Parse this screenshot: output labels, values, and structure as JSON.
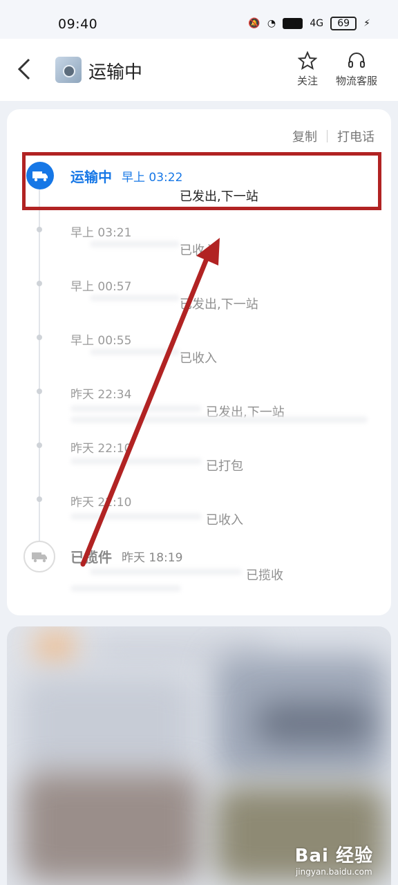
{
  "status_bar": {
    "time": "09:40",
    "network": "4G",
    "hd": "HD",
    "battery": "69"
  },
  "header": {
    "title": "运输中",
    "follow_label": "关注",
    "service_label": "物流客服"
  },
  "card": {
    "copy_label": "复制",
    "call_label": "打电话"
  },
  "timeline": {
    "current": {
      "status": "运输中",
      "time": "早上 03:22",
      "desc": "已发出,下一站"
    },
    "events": [
      {
        "time": "早上 03:21",
        "desc": "已收入"
      },
      {
        "time": "早上 00:57",
        "desc": "已发出,下一站"
      },
      {
        "time": "早上 00:55",
        "desc": "已收入"
      },
      {
        "time": "昨天 22:34",
        "desc": "已发出,下一站"
      },
      {
        "time": "昨天 22:10",
        "desc": "已打包"
      },
      {
        "time": "昨天 22:10",
        "desc": "已收入"
      }
    ],
    "first": {
      "status": "已揽件",
      "time": "昨天 18:19",
      "desc": "已揽收"
    }
  },
  "watermark": {
    "brand": "Bai 经验",
    "url": "jingyan.baidu.com"
  },
  "colors": {
    "accent": "#1677e6",
    "annotation": "#b12323"
  }
}
